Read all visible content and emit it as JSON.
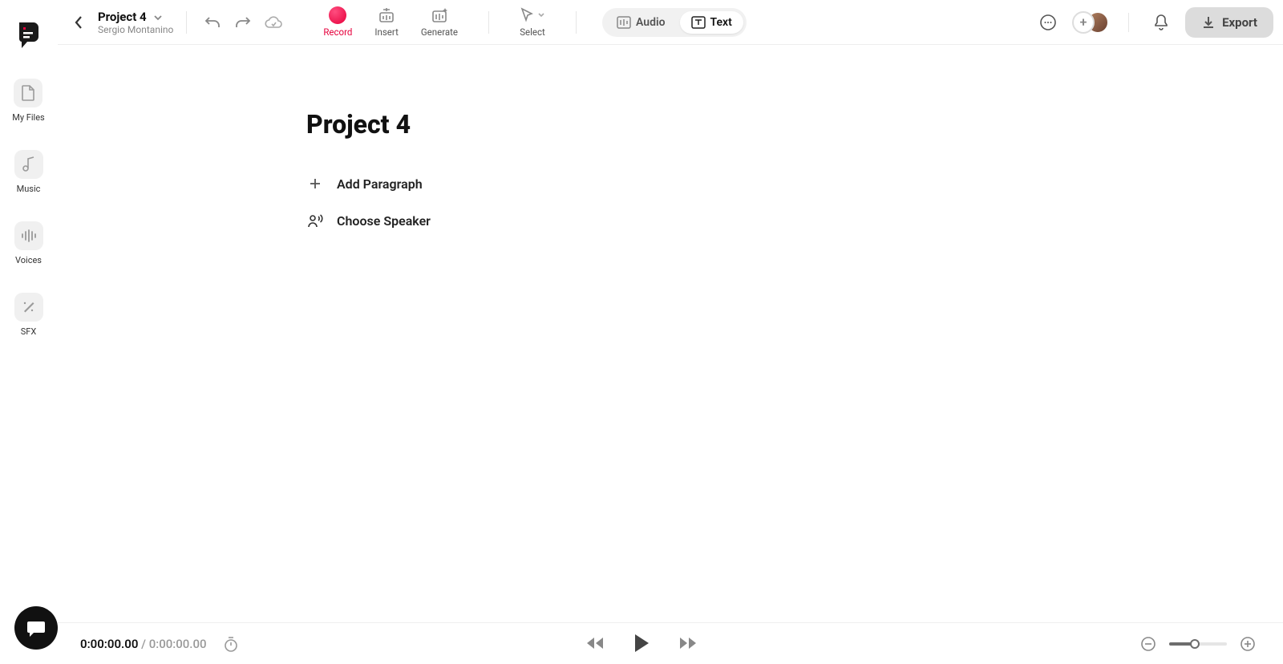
{
  "sidebar": {
    "items": [
      {
        "label": "My Files",
        "name": "my-files"
      },
      {
        "label": "Music",
        "name": "music"
      },
      {
        "label": "Voices",
        "name": "voices"
      },
      {
        "label": "SFX",
        "name": "sfx"
      }
    ]
  },
  "header": {
    "project_title": "Project 4",
    "owner": "Sergio Montanino",
    "modes": {
      "record": "Record",
      "insert": "Insert",
      "generate": "Generate",
      "select": "Select"
    },
    "view": {
      "audio": "Audio",
      "text": "Text"
    },
    "export": "Export"
  },
  "document": {
    "title": "Project 4",
    "add_paragraph": "Add Paragraph",
    "choose_speaker": "Choose Speaker"
  },
  "playback": {
    "current": "0:00:00.00",
    "sep": " / ",
    "duration": "0:00:00.00"
  }
}
